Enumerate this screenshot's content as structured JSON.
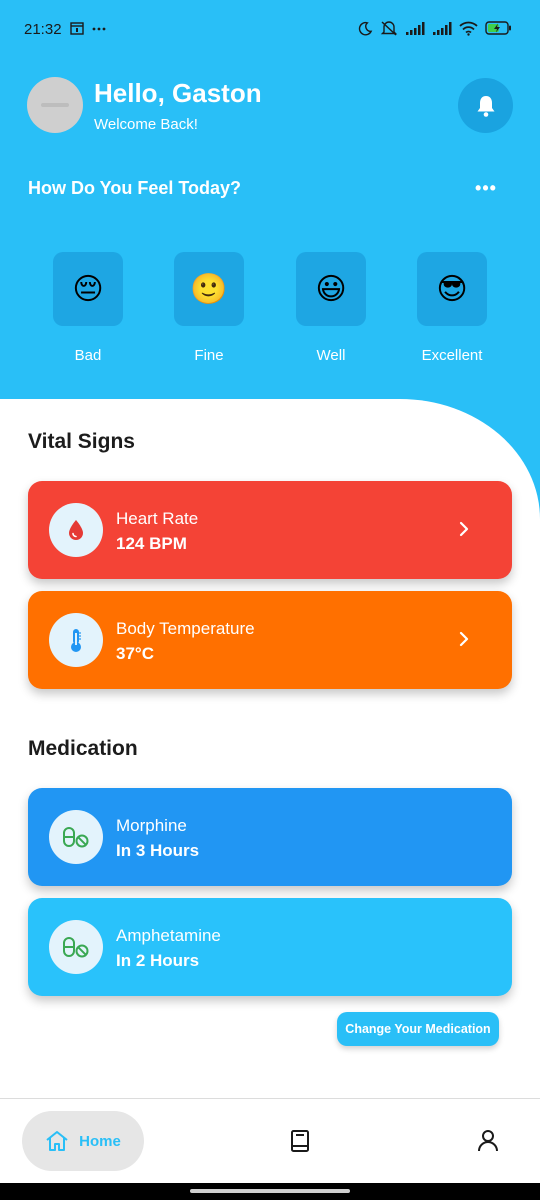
{
  "status_bar": {
    "time": "21:32",
    "battery_level": 0.6,
    "left_icons": [
      "calendar-icon",
      "more-dots-icon"
    ],
    "right_icons": [
      "moon-icon",
      "mute-icon",
      "signal-icon",
      "signal-icon",
      "wifi-icon",
      "battery-charging-icon"
    ]
  },
  "header": {
    "greeting": "Hello, Gaston",
    "welcome": "Welcome Back!",
    "avatar_icon": "avatar-placeholder",
    "bell_icon": "bell-icon",
    "background_color": "#29bff7"
  },
  "mood": {
    "title": "How Do You Feel Today?",
    "more_label": "•••",
    "options": [
      {
        "label": "Bad",
        "emoji": "😔"
      },
      {
        "label": "Fine",
        "emoji": "🙂"
      },
      {
        "label": "Well",
        "emoji": "😃"
      },
      {
        "label": "Excellent",
        "emoji": "😎"
      }
    ]
  },
  "vital_signs": {
    "title": "Vital Signs",
    "items": [
      {
        "title": "Heart Rate",
        "value": "124 BPM",
        "icon": "blood-drop-icon",
        "color": "#f44336"
      },
      {
        "title": "Body Temperature",
        "value": "37°C",
        "icon": "thermometer-icon",
        "color": "#ff7000"
      }
    ]
  },
  "medication": {
    "title": "Medication",
    "items": [
      {
        "name": "Morphine",
        "schedule": "In 3 Hours",
        "icon": "pill-icon",
        "color": "#2196f3"
      },
      {
        "name": "Amphetamine",
        "schedule": "In 2 Hours",
        "icon": "pill-icon",
        "color": "#29c2fb"
      }
    ],
    "change_button": "Change Your Medication"
  },
  "bottom_nav": {
    "items": [
      {
        "label": "Home",
        "icon": "home-icon",
        "active": true
      },
      {
        "label": "",
        "icon": "book-icon",
        "active": false
      },
      {
        "label": "",
        "icon": "person-icon",
        "active": false
      }
    ]
  }
}
